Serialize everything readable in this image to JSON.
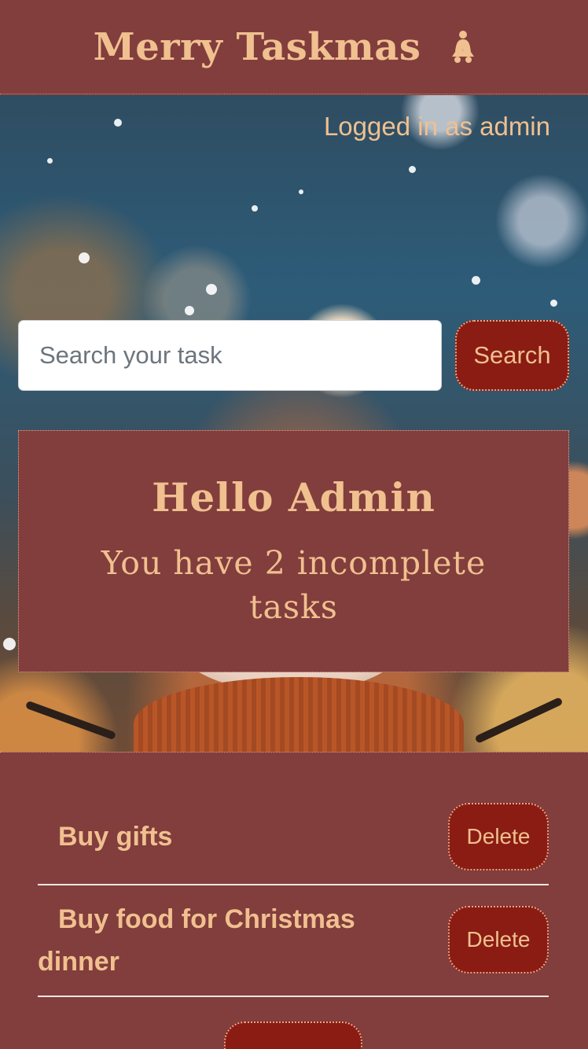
{
  "header": {
    "title": "Merry Taskmas",
    "icon": "bells-icon"
  },
  "session": {
    "status": "Logged in as admin"
  },
  "search": {
    "placeholder": "Search your task",
    "value": "",
    "button_label": "Search"
  },
  "greeting": {
    "title": "Hello Admin",
    "subtitle": "You have 2 incomplete tasks"
  },
  "tasks": [
    {
      "text": "Buy gifts",
      "delete_label": "Delete"
    },
    {
      "text": "Buy food for Christmas dinner",
      "delete_label": "Delete"
    }
  ],
  "colors": {
    "panel": "#823d3d",
    "button": "#8a1c14",
    "accent_text": "#f0c08f"
  }
}
